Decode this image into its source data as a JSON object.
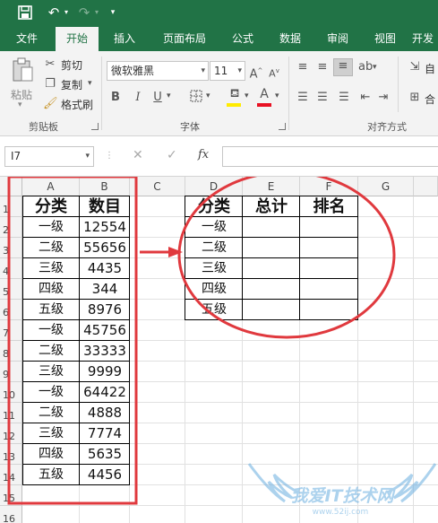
{
  "ribbon_tabs": [
    "文件",
    "开始",
    "插入",
    "页面布局",
    "公式",
    "数据",
    "审阅",
    "视图",
    "开发"
  ],
  "clipboard": {
    "paste": "粘贴",
    "cut": "剪切",
    "copy": "复制",
    "format_painter": "格式刷",
    "group_label": "剪贴板"
  },
  "font": {
    "name": "微软雅黑",
    "size": "11",
    "group_label": "字体",
    "font_color": "#e81123",
    "highlight_color": "#ffeb00"
  },
  "alignment": {
    "wrap": "自",
    "merge": "合",
    "group_label": "对齐方式"
  },
  "name_box": "I7",
  "formula_bar": {
    "fx": "fx"
  },
  "columns": [
    "A",
    "B",
    "C",
    "D",
    "E",
    "F",
    "G"
  ],
  "rows": [
    "1",
    "2",
    "3",
    "4",
    "5",
    "6",
    "7",
    "8",
    "9",
    "10",
    "11",
    "12",
    "13",
    "14",
    "15",
    "16"
  ],
  "table_left": {
    "headers": [
      "分类",
      "数目"
    ],
    "rows": [
      [
        "一级",
        "12554"
      ],
      [
        "二级",
        "55656"
      ],
      [
        "三级",
        "4435"
      ],
      [
        "四级",
        "344"
      ],
      [
        "五级",
        "8976"
      ],
      [
        "一级",
        "45756"
      ],
      [
        "二级",
        "33333"
      ],
      [
        "三级",
        "9999"
      ],
      [
        "一级",
        "64422"
      ],
      [
        "二级",
        "4888"
      ],
      [
        "三级",
        "7774"
      ],
      [
        "四级",
        "5635"
      ],
      [
        "五级",
        "4456"
      ]
    ]
  },
  "table_right": {
    "headers": [
      "分类",
      "总计",
      "排名"
    ],
    "categories": [
      "一级",
      "二级",
      "三级",
      "四级",
      "五级"
    ]
  },
  "annotation_color": "#e0393e",
  "watermark": {
    "text": "我爱IT技术网",
    "url": "www.52ij.com"
  }
}
